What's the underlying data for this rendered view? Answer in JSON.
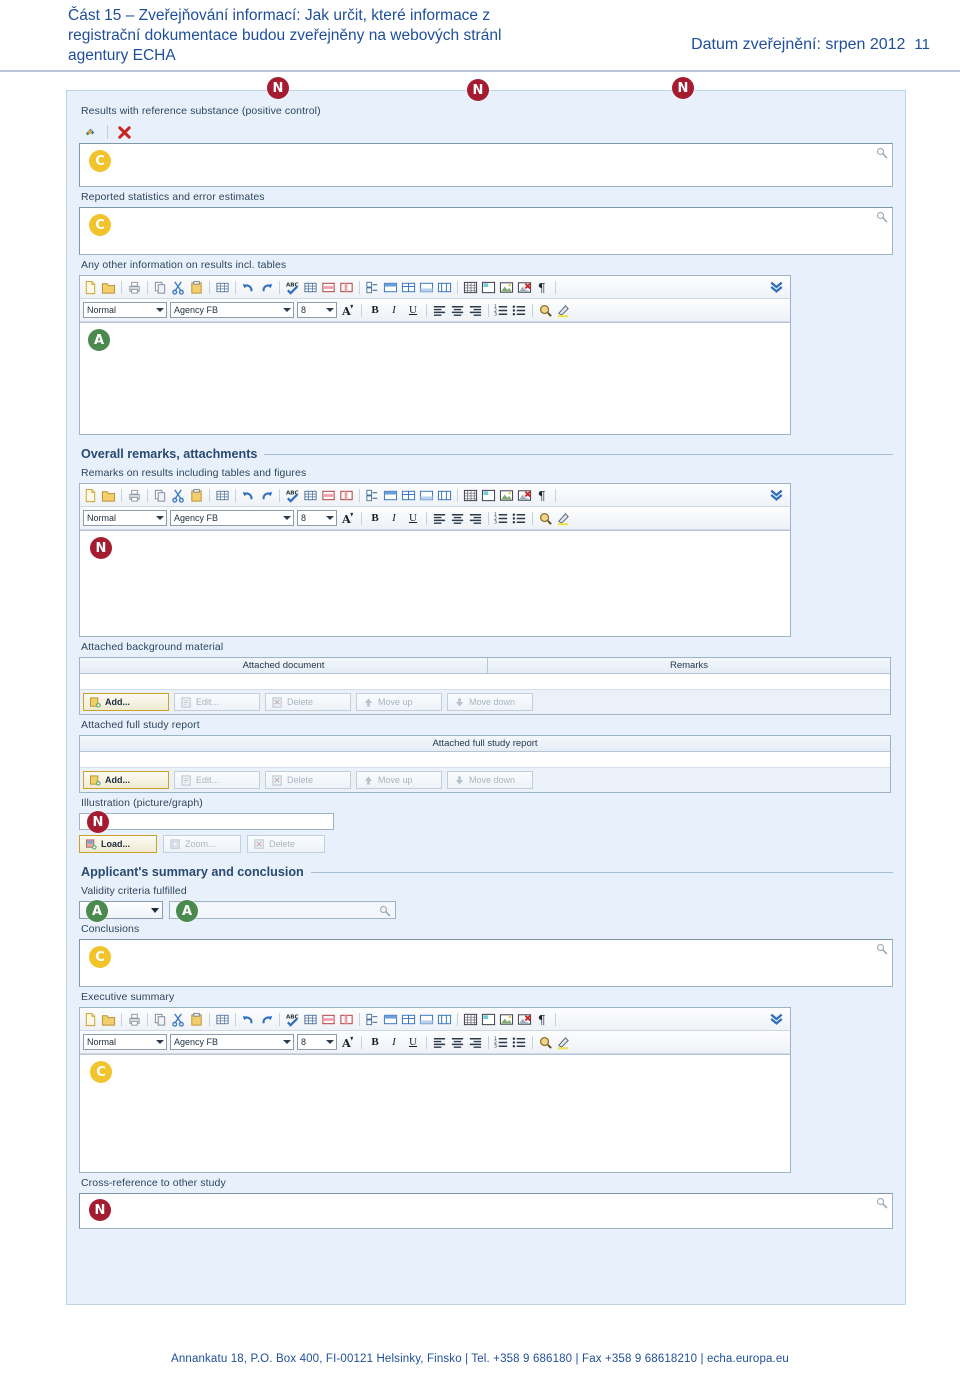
{
  "header": {
    "title": "Část 15 – Zveřejňování informací: Jak určit, které informace z\nregistrační dokumentace budou zveřejněny na webových stránl\nagentury ECHA",
    "date": "Datum zveřejnění: srpen 2012",
    "page_number": "11"
  },
  "form": {
    "results_reference_label": "Results with reference substance (positive control)",
    "reported_statistics_label": "Reported statistics and error estimates",
    "any_other_info_label": "Any other information on results incl. tables",
    "overall_remarks_section": "Overall remarks, attachments",
    "remarks_on_results_label": "Remarks on results including tables and figures",
    "attached_background_label": "Attached background material",
    "attached_full_report_label": "Attached full study report",
    "illustration_label": "Illustration (picture/graph)",
    "applicants_summary_section": "Applicant's summary and conclusion",
    "validity_criteria_label": "Validity criteria fulfilled",
    "conclusions_label": "Conclusions",
    "executive_summary_label": "Executive summary",
    "cross_reference_label": "Cross-reference to other study"
  },
  "rte": {
    "style_value": "Normal",
    "font_value": "Agency FB",
    "size_value": "8",
    "bold": "B",
    "italic": "I",
    "underline": "U"
  },
  "tables": {
    "background": {
      "columns": [
        "Attached document",
        "Remarks"
      ],
      "rows": []
    },
    "full_report": {
      "columns": [
        "Attached full study report"
      ],
      "rows": []
    },
    "buttons": [
      "Add...",
      "Edit...",
      "Delete",
      "Move up",
      "Move down"
    ]
  },
  "illustration_buttons": [
    "Load...",
    "Zoom...",
    "Delete"
  ],
  "markers": {
    "confidential": "C",
    "not_public": "N",
    "always_public": "A"
  },
  "colors": {
    "marker_confidential": "#f2c42c",
    "marker_not_public": "#a51c30",
    "marker_always_public": "#4a8a4e",
    "panel_background": "#e8f1fb",
    "header_text": "#1f4e9c"
  },
  "footer": {
    "text": "Annankatu 18, P.O. Box 400, FI-00121 Helsinky, Finsko | Tel. +358 9 686180 | Fax +358 9 68618210 | echa.europa.eu"
  }
}
